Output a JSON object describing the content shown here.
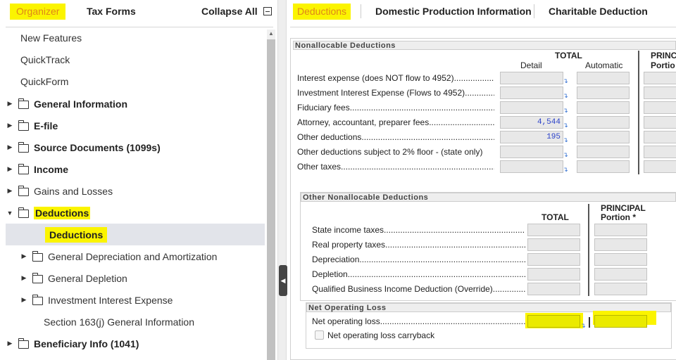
{
  "left_tabs": {
    "organizer": "Organizer",
    "tax_forms": "Tax Forms",
    "collapse_all": "Collapse All",
    "collapse_icon": "minus-box-icon"
  },
  "tree_plain": [
    "New Features",
    "QuickTrack",
    "QuickForm"
  ],
  "tree": [
    {
      "label": "General Information",
      "bold": true,
      "level": 0,
      "caret": "▶",
      "folder": true
    },
    {
      "label": "E-file",
      "bold": true,
      "level": 0,
      "caret": "▶",
      "folder": true
    },
    {
      "label": "Source Documents (1099s)",
      "bold": true,
      "level": 0,
      "caret": "▶",
      "folder": true
    },
    {
      "label": "Income",
      "bold": true,
      "level": 0,
      "caret": "▶",
      "folder": true
    },
    {
      "label": "Gains and Losses",
      "bold": false,
      "level": 0,
      "caret": "▶",
      "folder": true
    },
    {
      "label": "Deductions",
      "bold": true,
      "level": 0,
      "caret": "▼",
      "folder": true,
      "highlight": true
    },
    {
      "label": "Deductions",
      "bold": true,
      "level": 1,
      "caret": "",
      "folder": false,
      "highlight": true,
      "selected": true
    },
    {
      "label": "General Depreciation and Amortization",
      "bold": false,
      "level": 1,
      "caret": "▶",
      "folder": true
    },
    {
      "label": "General Depletion",
      "bold": false,
      "level": 1,
      "caret": "▶",
      "folder": true
    },
    {
      "label": "Investment Interest Expense",
      "bold": false,
      "level": 1,
      "caret": "▶",
      "folder": true
    },
    {
      "label": "Section 163(j) General Information",
      "bold": false,
      "level": 1,
      "caret": "",
      "folder": false
    },
    {
      "label": "Beneficiary Info (1041)",
      "bold": true,
      "level": 0,
      "caret": "▶",
      "folder": true
    }
  ],
  "right_tabs": {
    "deductions": "Deductions",
    "domestic": "Domestic Production Information",
    "charitable": "Charitable Deduction"
  },
  "nonallocable": {
    "title": "Nonallocable Deductions",
    "total_header": "TOTAL",
    "detail_header": "Detail",
    "automatic_header": "Automatic",
    "principal_header_line1": "PRINC",
    "principal_header_line2": "Portio",
    "rows": [
      {
        "label": "Interest expense (does NOT flow to 4952)......................",
        "detail": ""
      },
      {
        "label": "Investment Interest Expense (Flows to 4952)..............................",
        "detail": ""
      },
      {
        "label": "Fiduciary fees............................................................................................",
        "detail": ""
      },
      {
        "label": "Attorney, accountant, preparer fees..................................................",
        "detail": "4,544"
      },
      {
        "label": "Other deductions..........................................................................................",
        "detail": "195"
      },
      {
        "label": "Other deductions subject to 2% floor - (state only)",
        "detail": ""
      },
      {
        "label": "Other taxes...............................................................................................",
        "detail": ""
      }
    ]
  },
  "other_nonallocable": {
    "title": "Other Nonallocable Deductions",
    "total_header": "TOTAL",
    "principal_header_line1": "PRINCIPAL",
    "principal_header_line2": "Portion *",
    "rows": [
      {
        "label": "State income taxes......................................................................................"
      },
      {
        "label": "Real property taxes....................................................................................."
      },
      {
        "label": "Depreciation..............................................................................................."
      },
      {
        "label": "Depletion......................................................................................................."
      },
      {
        "label": "Qualified Business Income Deduction (Override)..............."
      }
    ]
  },
  "nol": {
    "title": "Net Operating Loss",
    "label": "Net operating loss.......................................................................................",
    "carryback_label": "Net operating loss carryback"
  },
  "colors": {
    "highlight": "#fbf400",
    "link_value": "#2a41c9",
    "selected_row": "#e2e4ea"
  }
}
